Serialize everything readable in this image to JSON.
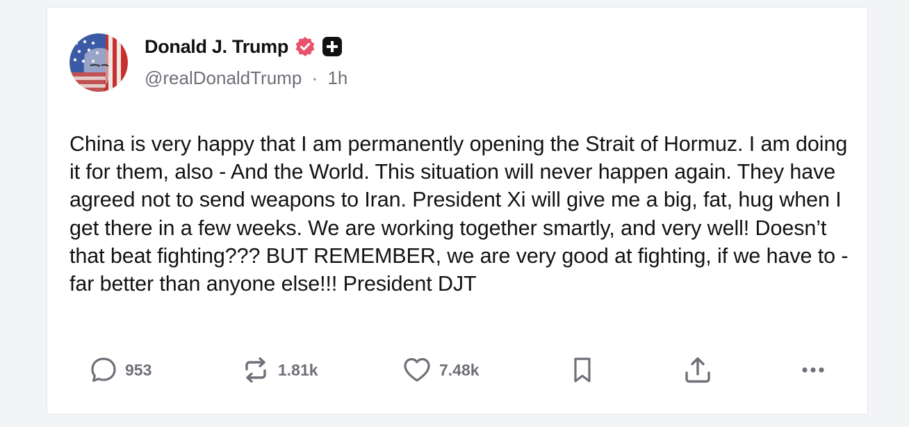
{
  "post": {
    "author": {
      "display_name": "Donald J. Trump",
      "handle": "@realDonaldTrump",
      "separator": "·",
      "time_ago": "1h",
      "verified_icon": "verified-badge-icon",
      "plus_icon": "plus-badge-icon",
      "verified_color": "#e8526a"
    },
    "body": "China is very happy that I am permanently opening the Strait of Hormuz. I am doing it for them, also - And the World. This situation will never happen again. They have agreed not to send weapons to Iran. President Xi will give me a big, fat, hug when I get there in a few weeks. We are working together smartly, and very well! Doesn’t that beat fighting??? BUT REMEMBER, we are very good at fighting, if we have to - far better than anyone else!!! President DJT",
    "actions": {
      "replies": "953",
      "retruths": "1.81k",
      "likes": "7.48k"
    }
  }
}
